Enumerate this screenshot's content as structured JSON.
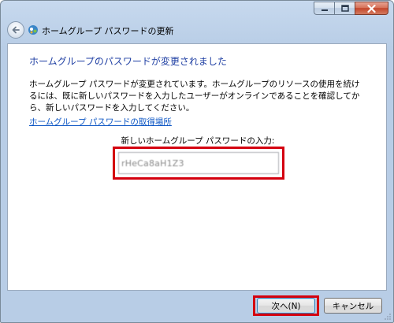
{
  "window": {
    "title": "ホームグループ パスワードの更新"
  },
  "caption": {
    "minimize_icon": "minimize-icon",
    "maximize_icon": "maximize-icon",
    "close_icon": "close-icon"
  },
  "content": {
    "heading": "ホームグループのパスワードが変更されました",
    "description": "ホームグループ パスワードが変更されています。ホームグループのリソースの使用を続けるには、既に新しいパスワードを入力したユーザーがオンラインであることを確認してから、新しいパスワードを入力してください。",
    "link": "ホームグループ パスワードの取得場所",
    "input_label": "新しいホームグループ パスワードの入力:",
    "password_value": "rHeCa8aH1Z3"
  },
  "footer": {
    "next_label": "次へ(N)",
    "cancel_label": "キャンセル"
  },
  "colors": {
    "highlight": "#d4000f",
    "heading": "#1f3fa3",
    "link": "#0b55c4"
  }
}
